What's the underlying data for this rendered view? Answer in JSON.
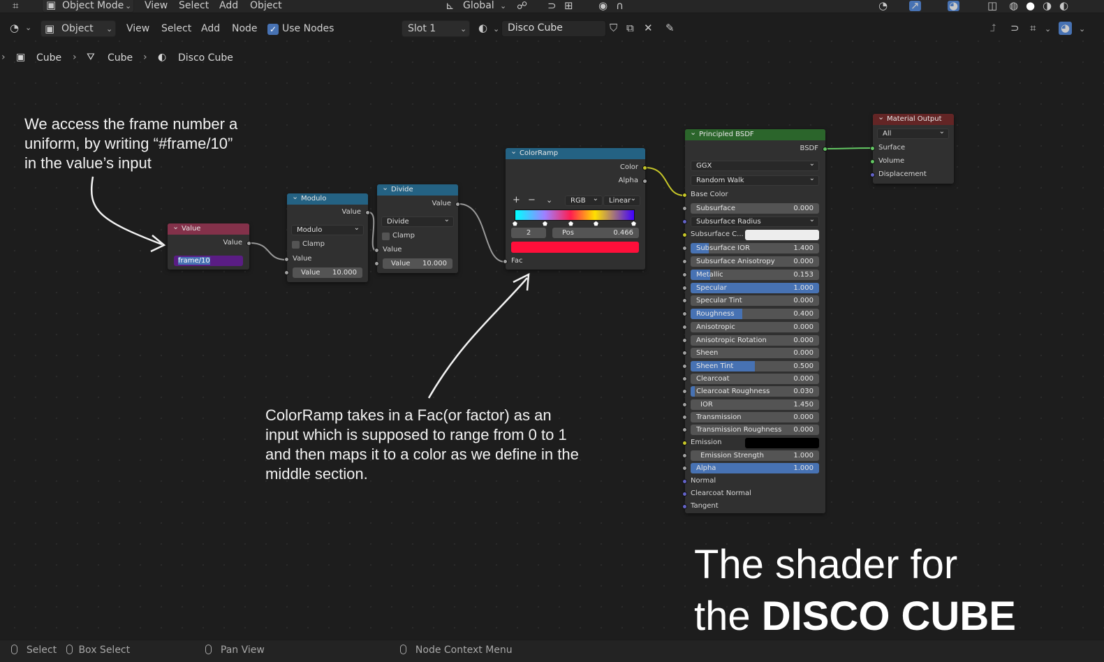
{
  "topbar": {
    "mode": "Object Mode",
    "menu": [
      "View",
      "Select",
      "Add",
      "Object"
    ],
    "transform": "Global"
  },
  "header": {
    "editor_type": "Object",
    "menu": [
      "View",
      "Select",
      "Add",
      "Node"
    ],
    "use_nodes_label": "Use Nodes",
    "slot": "Slot 1",
    "material": "Disco Cube"
  },
  "breadcrumb": [
    "Cube",
    "Cube",
    "Disco Cube"
  ],
  "nodes": {
    "value": {
      "title": "Value",
      "out": "Value",
      "field": "frame/10"
    },
    "modulo": {
      "title": "Modulo",
      "out": "Value",
      "op": "Modulo",
      "clamp": "Clamp",
      "in1": "Value",
      "in2_label": "Value",
      "in2_value": "10.000"
    },
    "divide": {
      "title": "Divide",
      "out": "Value",
      "op": "Divide",
      "clamp": "Clamp",
      "in1": "Value",
      "in2_label": "Value",
      "in2_value": "10.000"
    },
    "colorramp": {
      "title": "ColorRamp",
      "out_color": "Color",
      "out_alpha": "Alpha",
      "plus": "+",
      "minus": "−",
      "mode": "RGB",
      "interp": "Linear",
      "index": "2",
      "pos_label": "Pos",
      "pos_value": "0.466",
      "color": "#ff0f3a",
      "in": "Fac"
    },
    "bsdf": {
      "title": "Principled BSDF",
      "out": "BSDF",
      "distribution": "GGX",
      "subsurface_method": "Random Walk",
      "base_color": "Base Color",
      "subsurface": {
        "label": "Subsurface",
        "value": "0.000",
        "fill": 0
      },
      "subsurface_radius": "Subsurface Radius",
      "subsurface_color": "Subsurface C...",
      "subsurface_ior": {
        "label": "Subsurface IOR",
        "value": "1.400",
        "fill": 0.14
      },
      "subsurface_anisotropy": {
        "label": "Subsurface Anisotropy",
        "value": "0.000",
        "fill": 0
      },
      "metallic": {
        "label": "Metallic",
        "value": "0.153",
        "fill": 0.153
      },
      "specular": {
        "label": "Specular",
        "value": "1.000",
        "fill": 1
      },
      "specular_tint": {
        "label": "Specular Tint",
        "value": "0.000",
        "fill": 0
      },
      "roughness": {
        "label": "Roughness",
        "value": "0.400",
        "fill": 0.4
      },
      "anisotropic": {
        "label": "Anisotropic",
        "value": "0.000",
        "fill": 0
      },
      "anisotropic_rotation": {
        "label": "Anisotropic Rotation",
        "value": "0.000",
        "fill": 0
      },
      "sheen": {
        "label": "Sheen",
        "value": "0.000",
        "fill": 0
      },
      "sheen_tint": {
        "label": "Sheen Tint",
        "value": "0.500",
        "fill": 0.5
      },
      "clearcoat": {
        "label": "Clearcoat",
        "value": "0.000",
        "fill": 0
      },
      "clearcoat_roughness": {
        "label": "Clearcoat Roughness",
        "value": "0.030",
        "fill": 0.03
      },
      "ior": {
        "label": "IOR",
        "value": "1.450",
        "fill": 0
      },
      "transmission": {
        "label": "Transmission",
        "value": "0.000",
        "fill": 0
      },
      "transmission_roughness": {
        "label": "Transmission Roughness",
        "value": "0.000",
        "fill": 0
      },
      "emission": "Emission",
      "emission_strength": {
        "label": "Emission Strength",
        "value": "1.000",
        "fill": 0
      },
      "alpha": {
        "label": "Alpha",
        "value": "1.000",
        "fill": 1
      },
      "normal": "Normal",
      "clearcoat_normal": "Clearcoat Normal",
      "tangent": "Tangent"
    },
    "output": {
      "title": "Material Output",
      "target": "All",
      "surface": "Surface",
      "volume": "Volume",
      "displacement": "Displacement"
    }
  },
  "annotations": {
    "note1": [
      "We access the frame number a",
      "uniform, by writing “#frame/10”",
      "in the value’s input"
    ],
    "note2": [
      "ColorRamp takes in a Fac(or factor) as an",
      "input which is supposed to range from 0 to 1",
      "and then maps it to a color as we define in the",
      "middle section."
    ],
    "title_line1": "The shader for",
    "title_line2_prefix": "the ",
    "title_line2_bold": "DISCO CUBE"
  },
  "status": {
    "select": "Select",
    "box_select": "Box Select",
    "pan_view": "Pan View",
    "context_menu": "Node Context Menu"
  }
}
